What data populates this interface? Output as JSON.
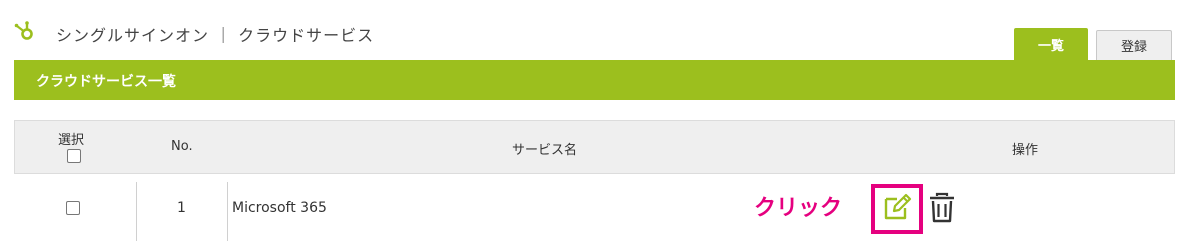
{
  "header": {
    "title": "シングルサインオン ｜ クラウドサービス",
    "logo_icon": "hubspot-sprocket-icon",
    "accent_color": "#9cbf1e"
  },
  "tabs": [
    {
      "label": "一覧",
      "active": true
    },
    {
      "label": "登録",
      "active": false
    }
  ],
  "section": {
    "title": "クラウドサービス一覧"
  },
  "table": {
    "columns": {
      "select": "選択",
      "no": "No.",
      "service_name": "サービス名",
      "operations": "操作"
    },
    "rows": [
      {
        "no": "1",
        "service_name": "Microsoft 365",
        "checked": false
      }
    ]
  },
  "annotation": {
    "label": "クリック",
    "color": "#e5007f"
  },
  "icons": {
    "edit": "edit-pencil-icon",
    "delete": "trash-icon"
  }
}
